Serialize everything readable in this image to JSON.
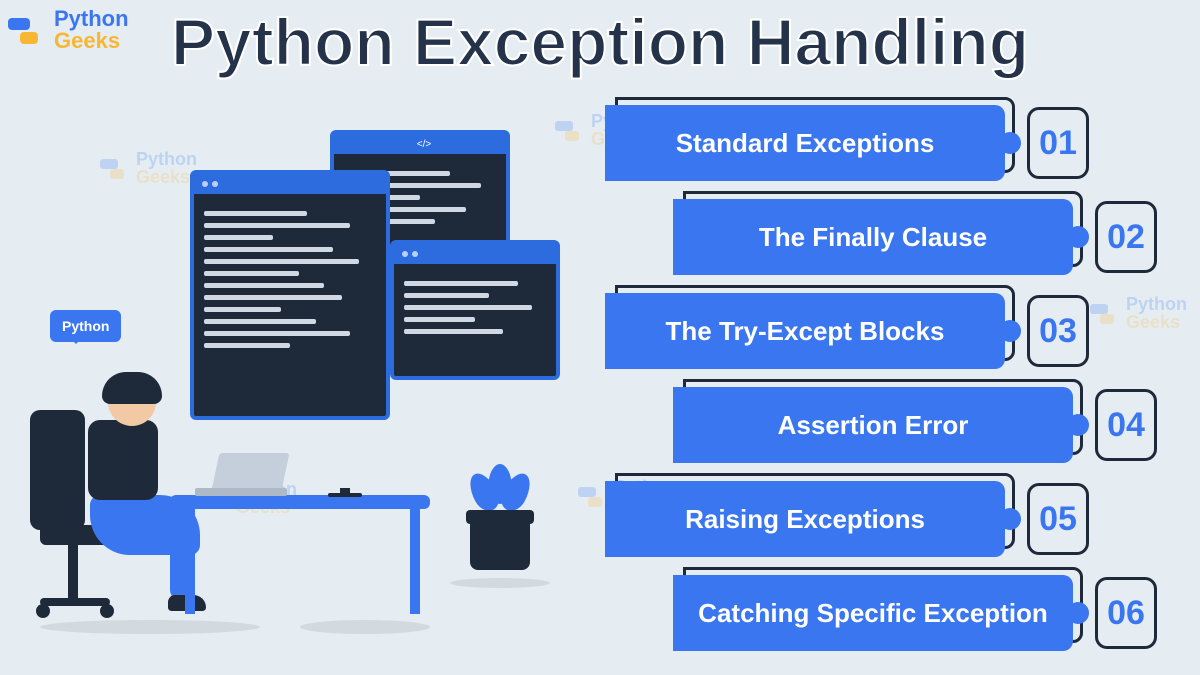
{
  "logo": {
    "line1": "Python",
    "line2": "Geeks"
  },
  "title": "Python Exception Handling",
  "speech_label": "Python",
  "watermark": {
    "line1": "Python",
    "line2": "Geeks"
  },
  "items": [
    {
      "label": "Standard Exceptions",
      "num": "01"
    },
    {
      "label": "The Finally Clause",
      "num": "02"
    },
    {
      "label": "The Try-Except Blocks",
      "num": "03"
    },
    {
      "label": "Assertion Error",
      "num": "04"
    },
    {
      "label": "Raising Exceptions",
      "num": "05"
    },
    {
      "label": "Catching Specific Exception",
      "num": "06"
    }
  ]
}
